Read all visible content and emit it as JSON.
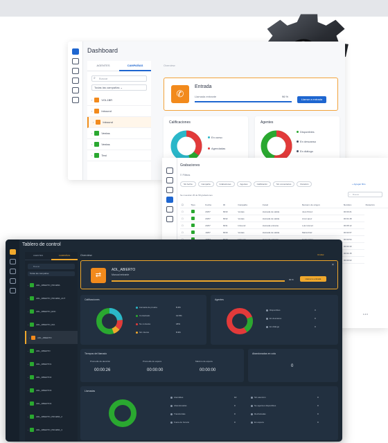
{
  "colors": {
    "accent_blue": "#1e66d0",
    "accent_orange": "#f28a1c",
    "dark_bg": "#1c2834",
    "green": "#2aa830",
    "red": "#e23a3a"
  },
  "gear": {
    "icon": "gear-icon"
  },
  "light_dashboard": {
    "title": "Dashboard",
    "tabs": [
      "AGENTES",
      "CAMPAÑAS"
    ],
    "search_placeholder": "Buscar",
    "select_value": "Todas las campañas",
    "overview": "Overview",
    "agents": [
      {
        "label": "VOL1BR",
        "color": "#f28a1c"
      },
      {
        "label": "Inbound",
        "color": "#f28a1c"
      },
      {
        "label": "Inbound",
        "color": "#f28a1c"
      },
      {
        "label": "Ventas",
        "color": "#2aa830"
      },
      {
        "label": "Ventas",
        "color": "#2aa830"
      },
      {
        "label": "Test",
        "color": "#2aa830"
      }
    ],
    "entrada": {
      "title": "Entrada",
      "subtitle": "Llamada entrante",
      "percent": "96 %",
      "button": "Llamar a entrada"
    },
    "calificaciones": {
      "title": "Calificaciones",
      "legend": [
        "En curso",
        "Agendadas"
      ]
    },
    "agentes": {
      "title": "Agentes",
      "legend": [
        "Disponibles",
        "En descanso",
        "En diálogo"
      ]
    }
  },
  "list_view": {
    "title": "Grabaciones",
    "filters_label": "Filtros",
    "chips": [
      "Sin fecha",
      "Campaña",
      "Grabaciones",
      "Agentes",
      "Calificación",
      "Sin comentarios",
      "Duración"
    ],
    "add_filter": "+ Agregar filtro",
    "search_placeholder": "Buscar",
    "info": "Se muestran 25 de 58 grabaciones",
    "columns": [
      "Tipo",
      "Fecha",
      "ID",
      "Campaña",
      "Canal",
      "Numero de origen",
      "Nombre",
      "Duración"
    ],
    "rows": [
      [
        "20/07",
        "6633",
        "Ventas",
        "Llamada de salida",
        "Juan Pérez",
        "00:03:21"
      ],
      [
        "20/07",
        "6632",
        "Ventas",
        "Llamada de salida",
        "Ana López",
        "00:01:48"
      ],
      [
        "20/07",
        "6631",
        "Inbound",
        "Llamada entrante",
        "Luis Gómez",
        "00:05:12"
      ],
      [
        "19/07",
        "6630",
        "Ventas",
        "Llamada de salida",
        "María Ruiz",
        "00:02:07"
      ],
      [
        "19/07",
        "6629",
        "Inbound",
        "Llamada entrante",
        "Carlos Díaz",
        "00:00:54"
      ],
      [
        "19/07",
        "6628",
        "Ventas",
        "Llamada de salida",
        "Lucía Sanz",
        "00:04:33"
      ],
      [
        "18/07",
        "6627",
        "Ventas",
        "Llamada de salida",
        "Pedro Gil",
        "00:01:15"
      ],
      [
        "18/07",
        "6626",
        "Inbound",
        "Llamada entrante",
        "Sara Mora",
        "00:03:02"
      ]
    ],
    "pagination": "1 2 3"
  },
  "dark_dashboard": {
    "title": "Tablero de control",
    "tabs": [
      "AGENTES",
      "CAMPAÑAS"
    ],
    "search_placeholder": "Buscar",
    "select_value": "Todas las campañas",
    "overview": "Overview",
    "hide": "Ocultar",
    "agents": [
      {
        "label": "ADL_ABIERTO_PRUEBA",
        "color": "#2aa830"
      },
      {
        "label": "ADL_ABIERTO_PRUEBA_AUT",
        "color": "#2aa830"
      },
      {
        "label": "ADL_ABIERTO_ENC",
        "color": "#2aa830"
      },
      {
        "label": "ADL_ABIERTO_DIA",
        "color": "#2aa830"
      },
      {
        "label": "ADL_ABIERTO",
        "color": "#f28a1c"
      },
      {
        "label": "ADL_ABIERTO",
        "color": "#2aa830"
      },
      {
        "label": "ADL_ABIERTO1",
        "color": "#2aa830"
      },
      {
        "label": "ADL_ABIERTO2",
        "color": "#2aa830"
      },
      {
        "label": "ADL_ABIERTO3",
        "color": "#2aa830"
      },
      {
        "label": "ADL_ABIERTO4",
        "color": "#2aa830"
      },
      {
        "label": "ADL_ABIERTO_PRUEBA_2",
        "color": "#2aa830"
      },
      {
        "label": "ADL_ABIERTO_PRUEBA_3",
        "color": "#2aa830"
      }
    ],
    "campaign": {
      "name": "ADL_ABIERTO",
      "subtitle": "Manual entrante",
      "percent": "90 %",
      "button": "Llamar a entrada"
    },
    "calificaciones": {
      "title": "Calificaciones",
      "rows": [
        {
          "label": "Llamada de prueba",
          "value": "8.4%"
        },
        {
          "label": "Contactado",
          "value": "12.5%"
        },
        {
          "label": "No contesta",
          "value": "18%"
        },
        {
          "label": "Sin interés",
          "value": "8.3%"
        }
      ]
    },
    "agentes": {
      "title": "Agentes",
      "rows": [
        {
          "label": "Disponibles",
          "value": "3"
        },
        {
          "label": "En descanso",
          "value": "0"
        },
        {
          "label": "En diálogo",
          "value": "0"
        }
      ]
    },
    "tiempos": {
      "title": "Tiempos del llamado",
      "items": [
        {
          "label": "Promedio de atención",
          "value": "00:00:26"
        },
        {
          "label": "Promedio de espera",
          "value": "00:00:00"
        },
        {
          "label": "Máximo de espera",
          "value": "00:00:00"
        }
      ]
    },
    "abandonadas": {
      "title": "Abandonadas en cola",
      "value": "0"
    },
    "llamadas": {
      "title": "Llamadas",
      "left": [
        {
          "label": "Atendidas",
          "value": "10"
        },
        {
          "label": "Abandonadas",
          "value": "0"
        },
        {
          "label": "Transferidas",
          "value": "0"
        },
        {
          "label": "Fuera de horario",
          "value": "0"
        }
      ],
      "right": [
        {
          "label": "Sin atención",
          "value": "0"
        },
        {
          "label": "No agentes disponibles",
          "value": "0"
        },
        {
          "label": "Rechazadas",
          "value": "0"
        },
        {
          "label": "En espera",
          "value": "0"
        }
      ]
    }
  }
}
